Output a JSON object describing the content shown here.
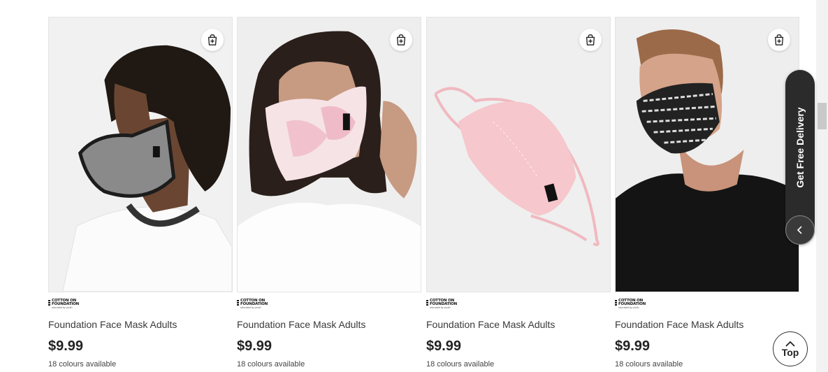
{
  "products": [
    {
      "brand_line1": "COTTON ON",
      "brand_line2": "FOUNDATION",
      "brand_tagline": "educated by youth",
      "name": "Foundation Face Mask Adults",
      "price": "$9.99",
      "colours": "18 colours available",
      "image": "man-houndstooth-mask"
    },
    {
      "brand_line1": "COTTON ON",
      "brand_line2": "FOUNDATION",
      "brand_tagline": "educated by youth",
      "name": "Foundation Face Mask Adults",
      "price": "$9.99",
      "colours": "18 colours available",
      "image": "woman-tie-dye-mask"
    },
    {
      "brand_line1": "COTTON ON",
      "brand_line2": "FOUNDATION",
      "brand_tagline": "educated by youth",
      "name": "Foundation Face Mask Adults",
      "price": "$9.99",
      "colours": "18 colours available",
      "image": "pink-mask-flatlay"
    },
    {
      "brand_line1": "COTTON ON",
      "brand_line2": "FOUNDATION",
      "brand_tagline": "educated by youth",
      "name": "Foundation Face Mask Adults",
      "price": "$9.99",
      "colours": "18 colours available",
      "image": "man-black-print-mask"
    }
  ],
  "add_to_bag_icon": "shopping-bag-plus-icon",
  "promo": {
    "label": "Get Free Delivery",
    "toggle_icon": "chevron-left-icon"
  },
  "back_to_top": {
    "label": "Top",
    "icon": "chevron-up-icon"
  },
  "colors": {
    "promo_bg": "#2b2b2b",
    "text": "#222222",
    "image_bg": "#f0f0f0"
  }
}
